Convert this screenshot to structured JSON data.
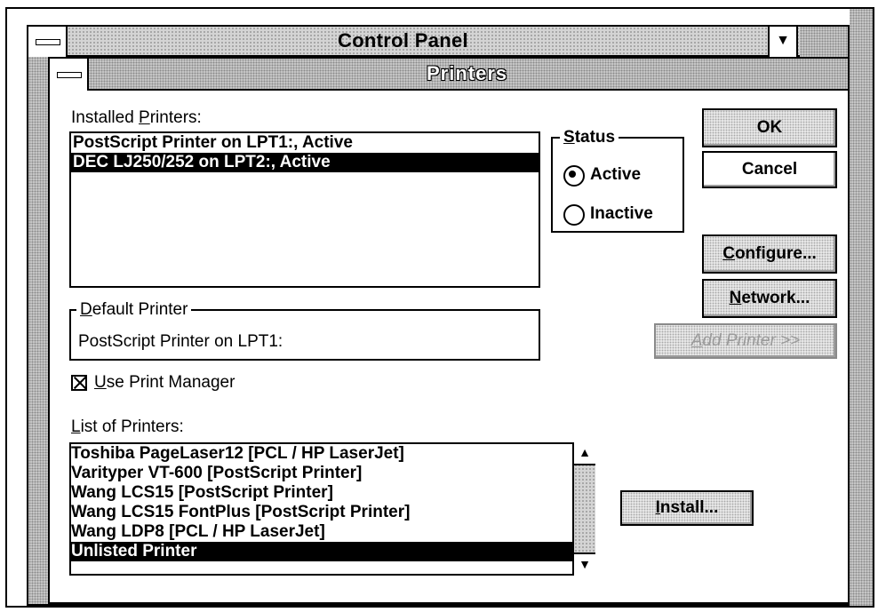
{
  "control_panel": {
    "title": "Control Panel",
    "dropdown_glyph": "▼"
  },
  "dialog": {
    "title": "Printers",
    "installed_label_pre": "Installed ",
    "installed_label_u": "P",
    "installed_label_post": "rinters:",
    "installed_printers": [
      {
        "name": "PostScript Printer on LPT1:, Active",
        "selected": false
      },
      {
        "name": "DEC LJ250/252 on LPT2:, Active",
        "selected": true
      }
    ],
    "status": {
      "label_u": "S",
      "label_rest": "tatus",
      "options": [
        {
          "label": "Active",
          "checked": true
        },
        {
          "label": "Inactive",
          "checked": false
        }
      ]
    },
    "buttons": {
      "ok": "OK",
      "cancel": "Cancel",
      "configure_u": "C",
      "configure_rest": "onfigure...",
      "network_u": "N",
      "network_rest": "etwork...",
      "add_printer_u": "A",
      "add_printer_rest": "dd Printer >>",
      "install_u": "I",
      "install_rest": "nstall..."
    },
    "default_printer": {
      "label_u": "D",
      "label_rest": "efault Printer",
      "value": "PostScript Printer on LPT1:"
    },
    "use_print_manager": {
      "label_u": "U",
      "label_rest": "se Print Manager",
      "checked": true
    },
    "list_label_u": "L",
    "list_label_rest": "ist of Printers:",
    "printer_list": [
      {
        "name": "Toshiba PageLaser12 [PCL / HP LaserJet]",
        "selected": false
      },
      {
        "name": "Varityper VT-600 [PostScript Printer]",
        "selected": false
      },
      {
        "name": "Wang LCS15 [PostScript Printer]",
        "selected": false
      },
      {
        "name": "Wang LCS15 FontPlus [PostScript Printer]",
        "selected": false
      },
      {
        "name": "Wang LDP8 [PCL / HP LaserJet]",
        "selected": false
      },
      {
        "name": "Unlisted Printer",
        "selected": true
      }
    ],
    "scroll_up_glyph": "▲",
    "scroll_down_glyph": "▼"
  }
}
